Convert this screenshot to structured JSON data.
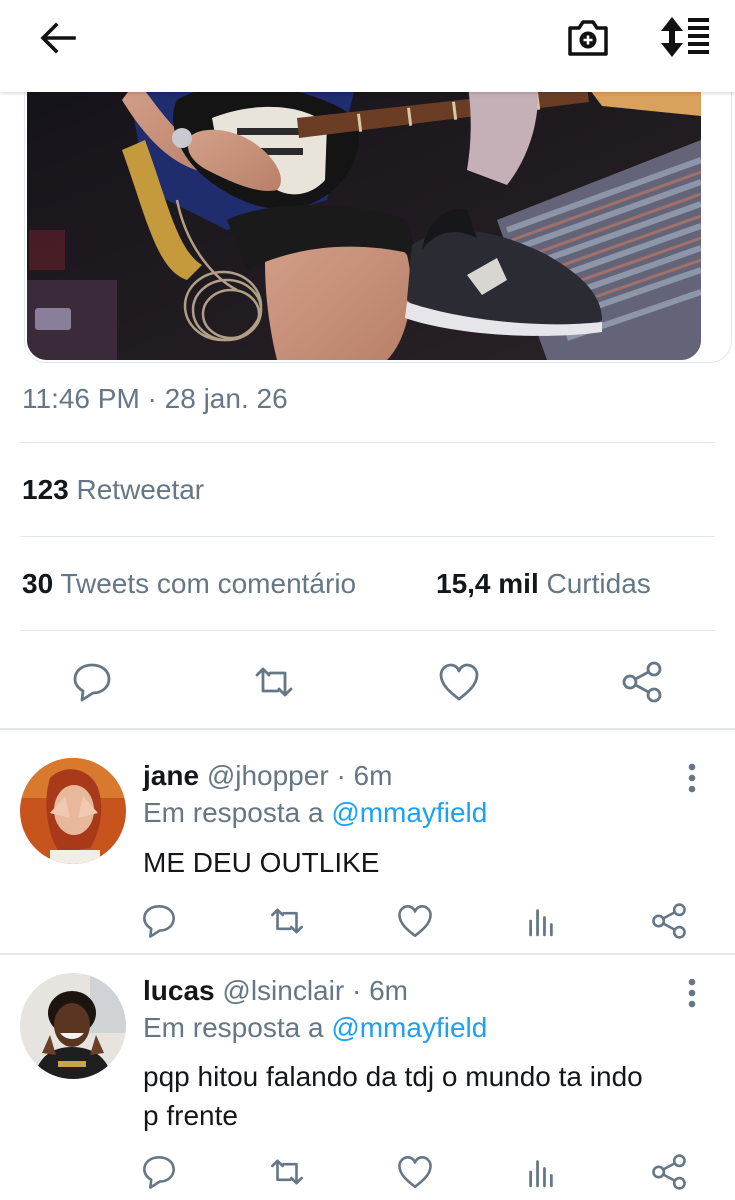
{
  "tweet": {
    "timestamp": "11:46 PM · 28 jan. 26",
    "stats": {
      "retweets_count": "123",
      "retweets_label": "Retweetar",
      "quotes_count": "30",
      "quotes_label": "Tweets com comentário",
      "likes_count": "15,4 mil",
      "likes_label": "Curtidas"
    }
  },
  "replies": [
    {
      "name": "jane",
      "handle": "@jhopper",
      "separator": "·",
      "time": "6m",
      "in_reply_prefix": "Em resposta a",
      "in_reply_mention": "@mmayfield",
      "text": "ME DEU OUTLIKE"
    },
    {
      "name": "lucas",
      "handle": "@lsinclair",
      "separator": "·",
      "time": "6m",
      "in_reply_prefix": "Em resposta a",
      "in_reply_mention": "@mmayfield",
      "text": "pqp hitou falando da tdj o mundo ta indo p frente"
    }
  ],
  "icons": {
    "header": [
      "back-arrow-icon",
      "camera-add-icon",
      "sort-icon"
    ],
    "actions": [
      "reply-icon",
      "retweet-icon",
      "like-icon",
      "analytics-icon",
      "share-icon"
    ]
  },
  "colors": {
    "accent": "#1da1f2",
    "secondary_text": "#657786",
    "primary_text": "#14171a",
    "divider": "#e1e8ed"
  }
}
